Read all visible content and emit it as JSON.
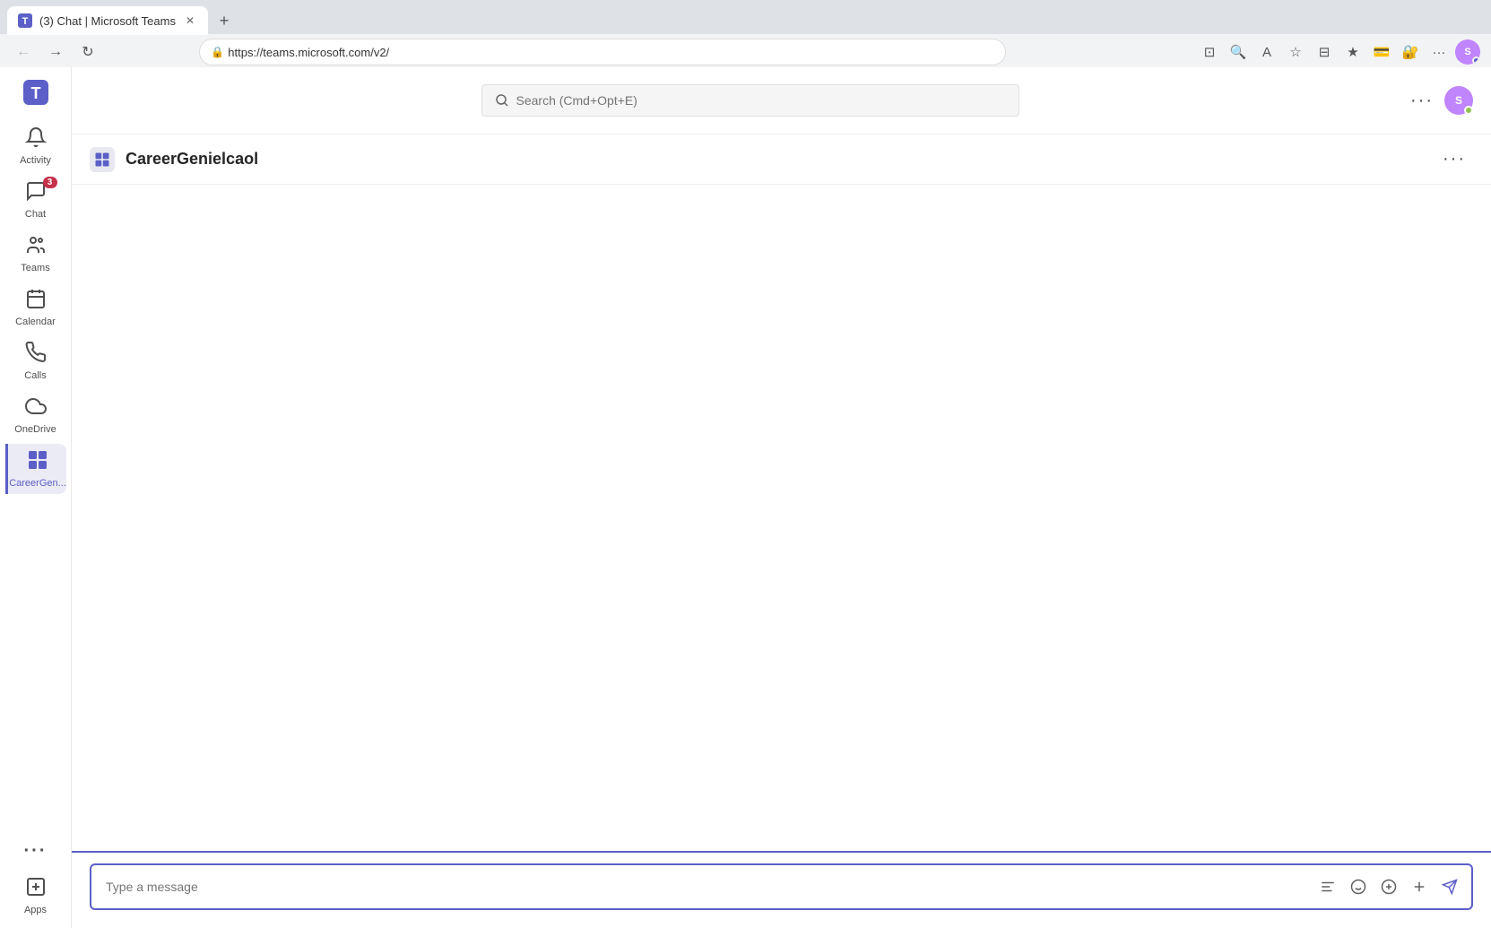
{
  "browser": {
    "tab": {
      "title": "(3) Chat | Microsoft Teams",
      "favicon": "T"
    },
    "address": "https://teams.microsoft.com/v2/",
    "search_placeholder": "Search (Cmd+Opt+E)"
  },
  "teams": {
    "logo": "T",
    "header": {
      "search_placeholder": "Search (Cmd+Opt+E)",
      "more_label": "···"
    },
    "sidebar": {
      "items": [
        {
          "id": "activity",
          "label": "Activity",
          "icon": "🔔",
          "badge": null,
          "active": false
        },
        {
          "id": "chat",
          "label": "Chat",
          "icon": "💬",
          "badge": "3",
          "active": false
        },
        {
          "id": "teams",
          "label": "Teams",
          "icon": "👥",
          "badge": null,
          "active": false
        },
        {
          "id": "calendar",
          "label": "Calendar",
          "icon": "📅",
          "badge": null,
          "active": false
        },
        {
          "id": "calls",
          "label": "Calls",
          "icon": "📞",
          "badge": null,
          "active": false
        },
        {
          "id": "onedrive",
          "label": "OneDrive",
          "icon": "☁",
          "badge": null,
          "active": false
        },
        {
          "id": "careergenie",
          "label": "CareerGen...",
          "icon": "⊞",
          "badge": null,
          "active": true
        }
      ],
      "more_label": "···",
      "apps_label": "Apps"
    },
    "channel": {
      "title": "CareerGenielcaol",
      "icon": "⊞",
      "more_options": "···"
    },
    "message_input": {
      "placeholder": "Type a message"
    }
  }
}
